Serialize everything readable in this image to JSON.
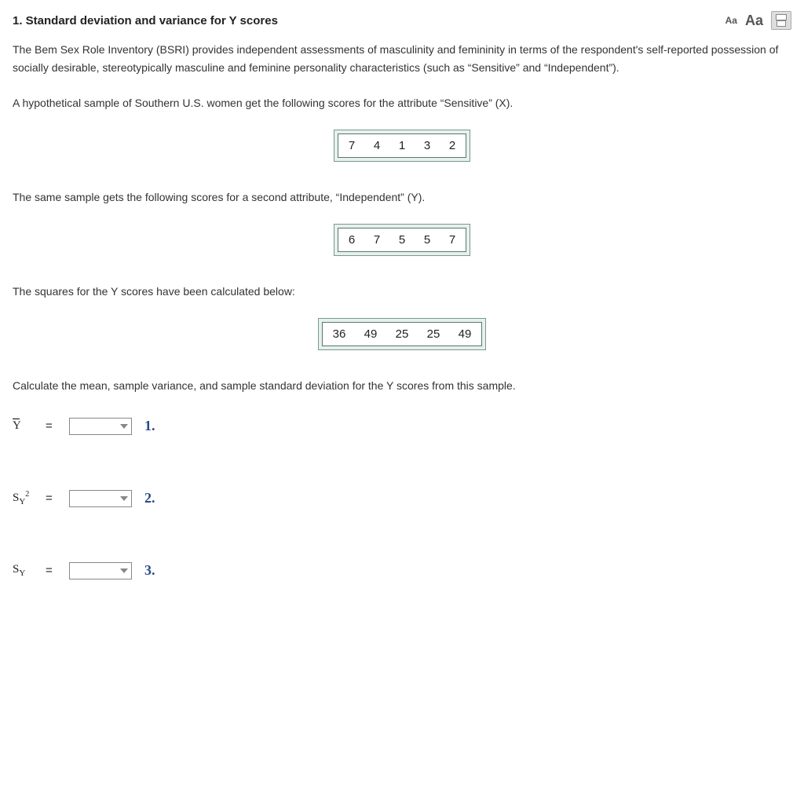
{
  "header": {
    "title": "1.  Standard deviation and variance for Y scores",
    "font_small": "Aa",
    "font_large": "Aa"
  },
  "paragraphs": {
    "intro": "The Bem Sex Role Inventory (BSRI) provides independent assessments of masculinity and femininity in terms of the respondent's self-reported possession of socially desirable, stereotypically masculine and feminine personality characteristics (such as “Sensitive” and “Independent”).",
    "sample_x": "A hypothetical sample of Southern U.S. women get the following scores for the attribute “Sensitive” (X).",
    "sample_y": "The same sample gets the following scores for a second attribute, “Independent” (Y).",
    "squares": "The squares for the Y scores have been calculated below:",
    "calculate": "Calculate the mean, sample variance, and sample standard deviation for the Y scores from this sample."
  },
  "data": {
    "x_scores": [
      "7",
      "4",
      "1",
      "3",
      "2"
    ],
    "y_scores": [
      "6",
      "7",
      "5",
      "5",
      "7"
    ],
    "y_squares": [
      "36",
      "49",
      "25",
      "25",
      "49"
    ]
  },
  "answers": {
    "mean": {
      "symbol_base": "Y",
      "equals": "=",
      "num": "1."
    },
    "variance": {
      "symbol_base": "S",
      "symbol_sub": "Y",
      "symbol_sup": "2",
      "equals": "=",
      "num": "2."
    },
    "sd": {
      "symbol_base": "S",
      "symbol_sub": "Y",
      "equals": "=",
      "num": "3."
    }
  }
}
